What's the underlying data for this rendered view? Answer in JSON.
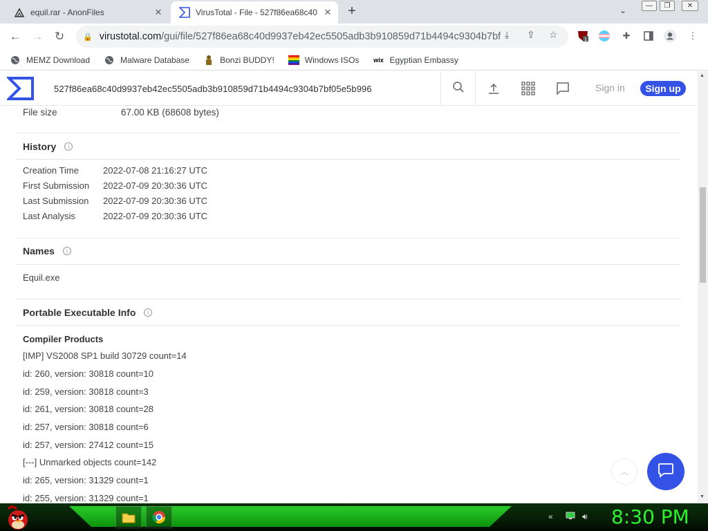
{
  "browser": {
    "tabs": [
      {
        "title": "equil.rar - AnonFiles",
        "active": false
      },
      {
        "title": "VirusTotal - File - 527f86ea68c40",
        "active": true
      }
    ],
    "new_tab_label": "+",
    "url_main": "virustotal.com",
    "url_rest": "/gui/file/527f86ea68c40d9937eb42ec5505adb3b910859d71b4494c9304b7bf0...",
    "extension_badge": "1"
  },
  "bookmarks": [
    {
      "label": "MEMZ Download",
      "icon": "globe-icon"
    },
    {
      "label": "Malware Database",
      "icon": "globe-icon"
    },
    {
      "label": "Bonzi BUDDY!",
      "icon": "bonzi-icon"
    },
    {
      "label": "Windows ISOs",
      "icon": "windows-flag-icon"
    },
    {
      "label": "Egyptian Embassy",
      "icon": "wix-icon"
    }
  ],
  "vt_header": {
    "search_value": "527f86ea68c40d9937eb42ec5505adb3b910859d71b4494c9304b7bf05e5b996",
    "sign_in": "Sign in",
    "sign_up": "Sign up"
  },
  "basic": {
    "file_size_label": "File size",
    "file_size_value": "67.00 KB (68608 bytes)"
  },
  "history": {
    "title": "History",
    "rows": [
      {
        "k": "Creation Time",
        "v": "2022-07-08 21:16:27 UTC"
      },
      {
        "k": "First Submission",
        "v": "2022-07-09 20:30:36 UTC"
      },
      {
        "k": "Last Submission",
        "v": "2022-07-09 20:30:36 UTC"
      },
      {
        "k": "Last Analysis",
        "v": "2022-07-09 20:30:36 UTC"
      }
    ]
  },
  "names": {
    "title": "Names",
    "items": [
      "Equil.exe"
    ]
  },
  "pe_info": {
    "title": "Portable Executable Info",
    "compiler_title": "Compiler Products",
    "products": [
      "[IMP] VS2008 SP1 build 30729 count=14",
      "id: 260, version: 30818 count=10",
      "id: 259, version: 30818 count=3",
      "id: 261, version: 30818 count=28",
      "id: 257, version: 30818 count=6",
      "id: 257, version: 27412 count=15",
      "[---] Unmarked objects count=142",
      "id: 265, version: 31329 count=1",
      "id: 255, version: 31329 count=1"
    ]
  },
  "taskbar": {
    "clock": "8:30 PM"
  },
  "colors": {
    "vt_blue": "#3452e5",
    "taskbar_green": "#2ef22e"
  }
}
